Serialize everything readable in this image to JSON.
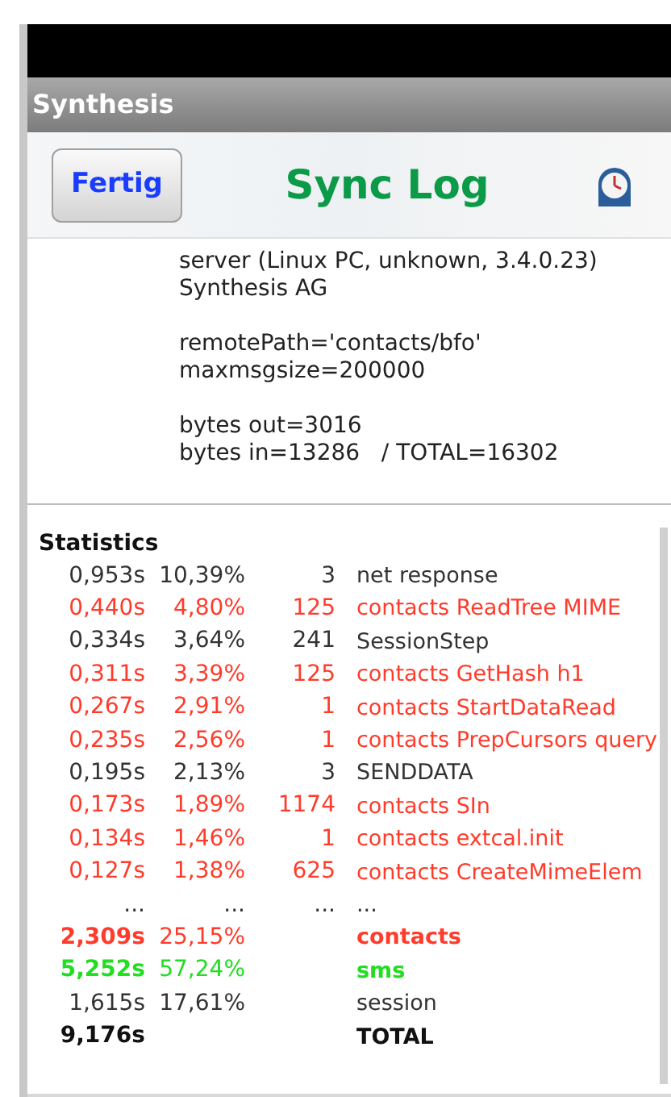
{
  "window": {
    "title": "Synthesis"
  },
  "header": {
    "button": "Fertig",
    "title": "Sync Log"
  },
  "info_paragraphs": [
    [
      "server (Linux PC, unknown, 3.4.0.23)",
      "Synthesis AG"
    ],
    [
      "remotePath='contacts/bfo'",
      "maxmsgsize=200000"
    ],
    [
      "bytes out=3016",
      "bytes in=13286   / TOTAL=16302"
    ]
  ],
  "statistics": {
    "heading": "Statistics",
    "rows": [
      {
        "time": "0,953s",
        "percent": "10,39%",
        "count": "3",
        "name": "net response",
        "color": "#333333",
        "emphasized": false
      },
      {
        "time": "0,440s",
        "percent": "4,80%",
        "count": "125",
        "name": "contacts ReadTree MIME",
        "color": "#ff3b2b",
        "emphasized": false
      },
      {
        "time": "0,334s",
        "percent": "3,64%",
        "count": "241",
        "name": "SessionStep",
        "color": "#333333",
        "emphasized": false
      },
      {
        "time": "0,311s",
        "percent": "3,39%",
        "count": "125",
        "name": "contacts GetHash h1",
        "color": "#ff3b2b",
        "emphasized": false
      },
      {
        "time": "0,267s",
        "percent": "2,91%",
        "count": "1",
        "name": "contacts StartDataRead",
        "color": "#ff3b2b",
        "emphasized": false
      },
      {
        "time": "0,235s",
        "percent": "2,56%",
        "count": "1",
        "name": "contacts PrepCursors query",
        "color": "#ff3b2b",
        "emphasized": false
      },
      {
        "time": "0,195s",
        "percent": "2,13%",
        "count": "3",
        "name": "SENDDATA",
        "color": "#333333",
        "emphasized": false
      },
      {
        "time": "0,173s",
        "percent": "1,89%",
        "count": "1174",
        "name": "contacts SIn",
        "color": "#ff3b2b",
        "emphasized": false
      },
      {
        "time": "0,134s",
        "percent": "1,46%",
        "count": "1",
        "name": "contacts extcal.init",
        "color": "#ff3b2b",
        "emphasized": false
      },
      {
        "time": "0,127s",
        "percent": "1,38%",
        "count": "625",
        "name": "contacts CreateMimeElem",
        "color": "#ff3b2b",
        "emphasized": false
      },
      {
        "time": "...",
        "percent": "...",
        "count": "...",
        "name": "...",
        "color": "#333333",
        "emphasized": false
      },
      {
        "time": "2,309s",
        "percent": "25,15%",
        "name": "contacts",
        "color": "#ff3b2b",
        "emphasized": true
      },
      {
        "time": "5,252s",
        "percent": "57,24%",
        "name": "sms",
        "color": "#22dd22",
        "emphasized": true
      },
      {
        "time": "1,615s",
        "percent": "17,61%",
        "name": "session",
        "color": "#333333",
        "emphasized": false
      },
      {
        "time": "9,176s",
        "name": "TOTAL",
        "color": "#111111",
        "emphasized": true
      }
    ]
  }
}
